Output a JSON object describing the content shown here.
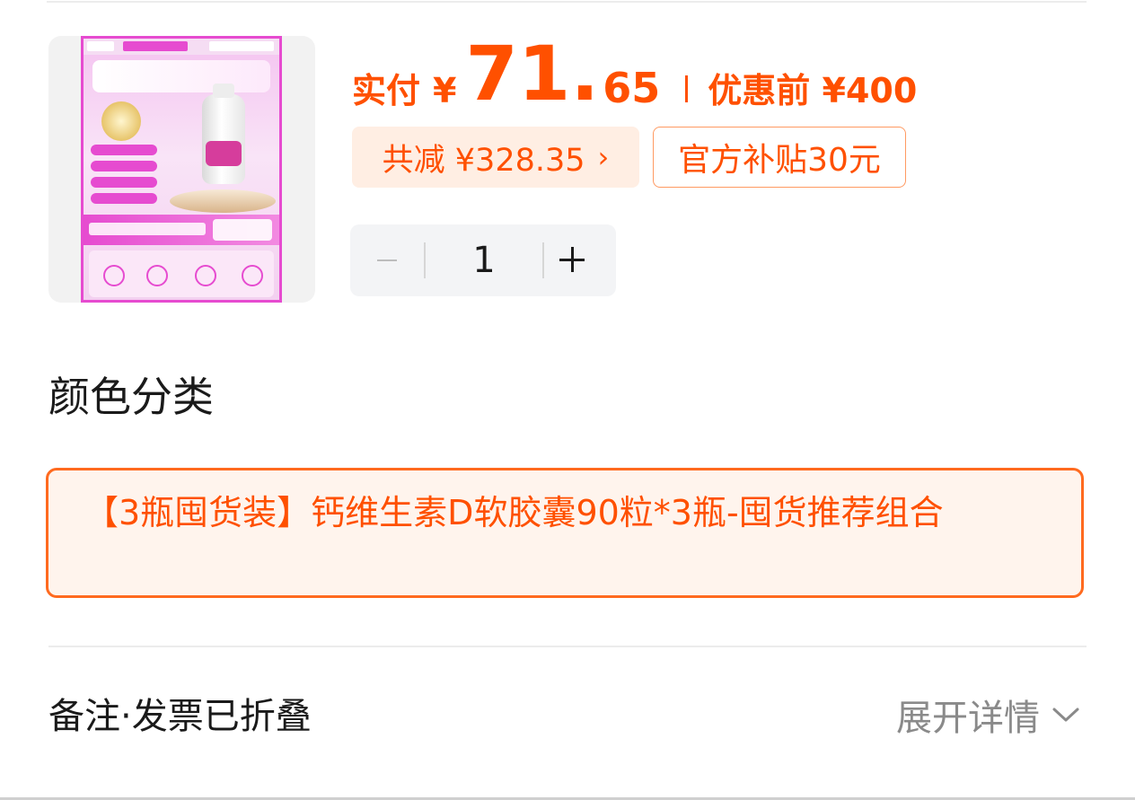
{
  "price": {
    "pay_label": "实付",
    "currency": "¥",
    "integer": "71.",
    "decimal": "65",
    "original_label": "优惠前 ¥400"
  },
  "discount": {
    "text": "共减 ¥328.35",
    "chevron": "›"
  },
  "subsidy": {
    "text": "官方补贴30元"
  },
  "quantity": {
    "value": "1"
  },
  "spec": {
    "title": "颜色分类",
    "selected": "【3瓶囤货装】钙维生素D软胶囊90粒*3瓶-囤货推荐组合"
  },
  "notes": {
    "label": "备注·发票已折叠",
    "expand": "展开详情"
  },
  "colors": {
    "accent": "#ff5000",
    "accent_border": "#ff6a1f",
    "chip_bg": "#ffeee3"
  }
}
